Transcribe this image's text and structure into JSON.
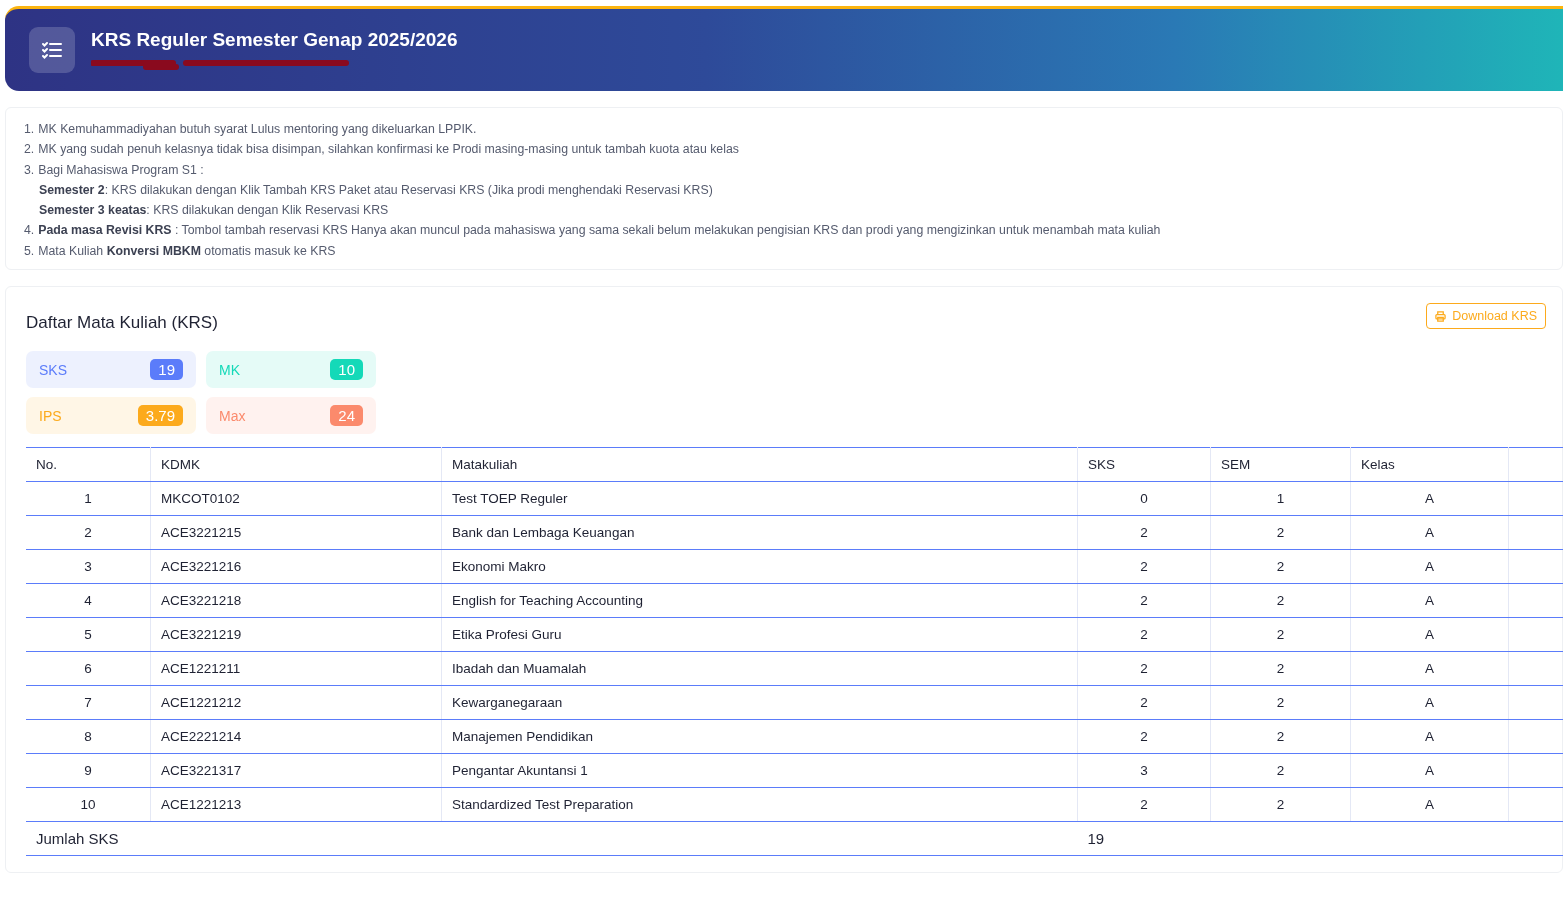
{
  "header": {
    "title": "KRS Reguler Semester Genap 2025/2026",
    "subtitle_redacted": true
  },
  "notes": [
    {
      "number": "1.",
      "text": "MK Kemuhammadiyahan butuh syarat Lulus mentoring yang dikeluarkan LPPIK."
    },
    {
      "number": "2.",
      "text": "MK yang sudah penuh kelasnya tidak bisa disimpan, silahkan konfirmasi ke Prodi masing-masing untuk tambah kuota atau kelas"
    },
    {
      "number": "3.",
      "text": "Bagi Mahasiswa Program S1 :",
      "sub_lines": [
        "**Semester 2**: KRS dilakukan dengan Klik Tambah KRS Paket atau Reservasi KRS (Jika prodi menghendaki Reservasi KRS)",
        "**Semester 3 keatas**: KRS dilakukan dengan Klik Reservasi KRS"
      ]
    },
    {
      "number": "4.",
      "text": "**Pada masa Revisi KRS** : Tombol tambah reservasi KRS Hanya akan muncul pada mahasiswa yang sama sekali belum melakukan pengisian KRS dan prodi yang mengizinkan untuk menambah mata kuliah"
    },
    {
      "number": "5.",
      "text": "Mata Kuliah **Konversi MBKM** otomatis masuk ke KRS"
    }
  ],
  "krs": {
    "title": "Daftar Mata Kuliah (KRS)",
    "download_button": "Download KRS",
    "stats": [
      {
        "label": "SKS",
        "value": "19",
        "color": "#5b7cfa"
      },
      {
        "label": "MK",
        "value": "10",
        "color": "#14d9b8"
      },
      {
        "label": "IPS",
        "value": "3.79",
        "color": "#fcaa1c"
      },
      {
        "label": "Max",
        "value": "24",
        "color": "#fb8a6c"
      }
    ],
    "table": {
      "columns": [
        "No.",
        "KDMK",
        "Matakuliah",
        "SKS",
        "SEM",
        "Kelas"
      ],
      "rows": [
        [
          "1",
          "MKCOT0102",
          "Test TOEP Reguler",
          "0",
          "1",
          "A"
        ],
        [
          "2",
          "ACE3221215",
          "Bank dan Lembaga Keuangan",
          "2",
          "2",
          "A"
        ],
        [
          "3",
          "ACE3221216",
          "Ekonomi Makro",
          "2",
          "2",
          "A"
        ],
        [
          "4",
          "ACE3221218",
          "English for Teaching Accounting",
          "2",
          "2",
          "A"
        ],
        [
          "5",
          "ACE3221219",
          "Etika Profesi Guru",
          "2",
          "2",
          "A"
        ],
        [
          "6",
          "ACE1221211",
          "Ibadah dan Muamalah",
          "2",
          "2",
          "A"
        ],
        [
          "7",
          "ACE1221212",
          "Kewarganegaraan",
          "2",
          "2",
          "A"
        ],
        [
          "8",
          "ACE2221214",
          "Manajemen Pendidikan",
          "2",
          "2",
          "A"
        ],
        [
          "9",
          "ACE3221317",
          "Pengantar Akuntansi 1",
          "3",
          "2",
          "A"
        ],
        [
          "10",
          "ACE1221213",
          "Standardized Test Preparation",
          "2",
          "2",
          "A"
        ]
      ],
      "footer": {
        "label": "Jumlah SKS",
        "total": "19"
      }
    }
  }
}
